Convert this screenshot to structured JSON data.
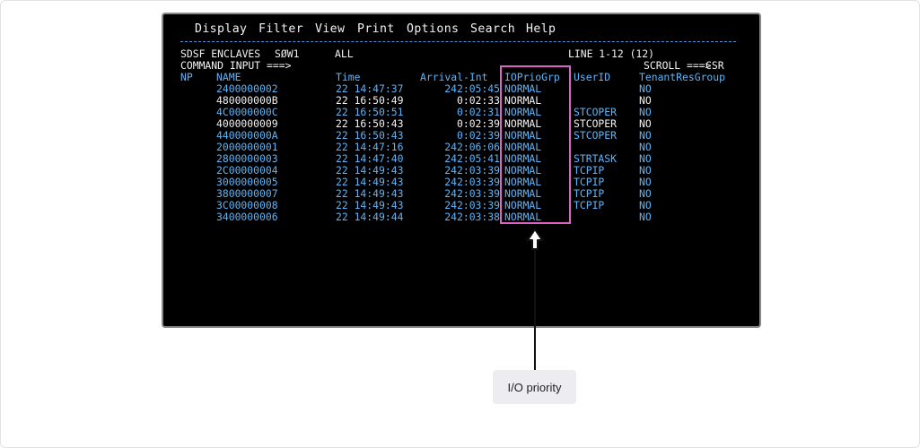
{
  "menu": [
    "Display",
    "Filter",
    "View",
    "Print",
    "Options",
    "Search",
    "Help"
  ],
  "header": {
    "panel": "SDSF ENCLAVES",
    "system": "SØW1",
    "scope": "ALL",
    "lines": "LINE 1-12 (12)",
    "command_label": "COMMAND INPUT ===>",
    "command_value": "",
    "scroll_label": "SCROLL ===>",
    "scroll_value": "CSR"
  },
  "columns": {
    "np": "NP",
    "name": "NAME",
    "time": "Time",
    "arrival": "Arrival-Int",
    "io": "IOPrioGrp",
    "user": "UserID",
    "tenant": "TenantResGroup"
  },
  "rows": [
    {
      "name": "2400000002",
      "time": "22 14:47:37",
      "arrival": "242:05:45",
      "io": "NORMAL",
      "user": "",
      "tenant": "NO",
      "color": "#5fb4f5"
    },
    {
      "name": "480000000B",
      "time": "22 16:50:49",
      "arrival": "0:02:33",
      "io": "NORMAL",
      "user": "",
      "tenant": "NO",
      "color": "#f2f2f2"
    },
    {
      "name": "4C0000000C",
      "time": "22 16:50:51",
      "arrival": "0:02:31",
      "io": "NORMAL",
      "user": "STCOPER",
      "tenant": "NO",
      "color": "#5fb4f5"
    },
    {
      "name": "4000000009",
      "time": "22 16:50:43",
      "arrival": "0:02:39",
      "io": "NORMAL",
      "user": "STCOPER",
      "tenant": "NO",
      "color": "#f2f2f2"
    },
    {
      "name": "440000000A",
      "time": "22 16:50:43",
      "arrival": "0:02:39",
      "io": "NORMAL",
      "user": "STCOPER",
      "tenant": "NO",
      "color": "#5fb4f5"
    },
    {
      "name": "2000000001",
      "time": "22 14:47:16",
      "arrival": "242:06:06",
      "io": "NORMAL",
      "user": "",
      "tenant": "NO",
      "color": "#5fb4f5"
    },
    {
      "name": "2800000003",
      "time": "22 14:47:40",
      "arrival": "242:05:41",
      "io": "NORMAL",
      "user": "STRTASK",
      "tenant": "NO",
      "color": "#5fb4f5"
    },
    {
      "name": "2C00000004",
      "time": "22 14:49:43",
      "arrival": "242:03:39",
      "io": "NORMAL",
      "user": "TCPIP",
      "tenant": "NO",
      "color": "#5fb4f5"
    },
    {
      "name": "3000000005",
      "time": "22 14:49:43",
      "arrival": "242:03:39",
      "io": "NORMAL",
      "user": "TCPIP",
      "tenant": "NO",
      "color": "#5fb4f5"
    },
    {
      "name": "3800000007",
      "time": "22 14:49:43",
      "arrival": "242:03:39",
      "io": "NORMAL",
      "user": "TCPIP",
      "tenant": "NO",
      "color": "#5fb4f5"
    },
    {
      "name": "3C00000008",
      "time": "22 14:49:43",
      "arrival": "242:03:39",
      "io": "NORMAL",
      "user": "TCPIP",
      "tenant": "NO",
      "color": "#5fb4f5"
    },
    {
      "name": "3400000006",
      "time": "22 14:49:44",
      "arrival": "242:03:38",
      "io": "NORMAL",
      "user": "",
      "tenant": "NO",
      "color": "#5fb4f5"
    }
  ],
  "callout": "I/O priority",
  "colors": {
    "terminal_bg": "#000000",
    "text_white": "#f2f2f2",
    "text_blue": "#5fb4f5",
    "highlight": "#e062c9",
    "callout_bg": "#ececf1"
  }
}
